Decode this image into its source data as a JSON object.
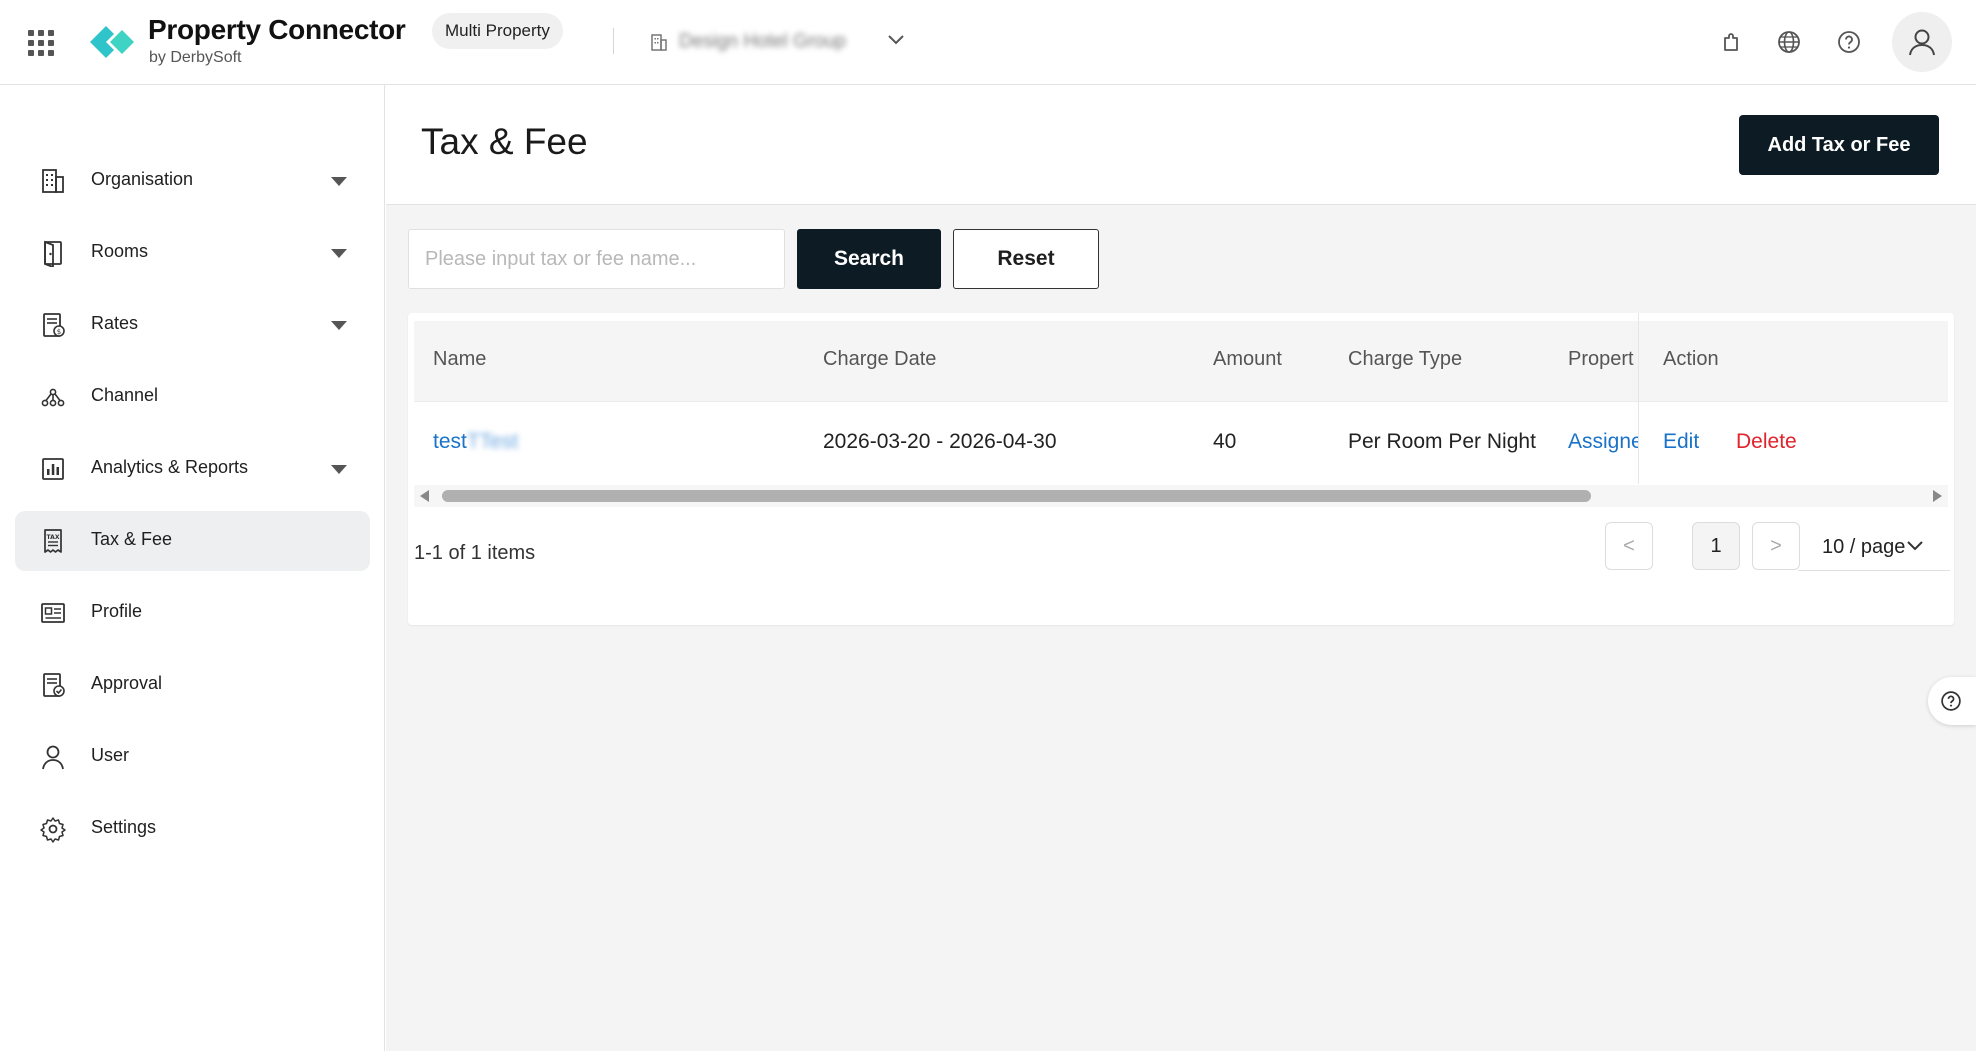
{
  "header": {
    "brand_title": "Property Connector",
    "brand_sub": "by DerbySoft",
    "mode_badge": "Multi Property",
    "org_name": "Design Hotel Group",
    "icons": [
      "apps-grid-icon",
      "logo-icon",
      "building-icon",
      "chevron-down-icon",
      "puzzle-icon",
      "globe-icon",
      "help-icon",
      "user-icon"
    ]
  },
  "sidebar": {
    "items": [
      {
        "label": "Organisation",
        "icon": "building-icon",
        "expandable": true
      },
      {
        "label": "Rooms",
        "icon": "door-icon",
        "expandable": true
      },
      {
        "label": "Rates",
        "icon": "rate-doc-icon",
        "expandable": true
      },
      {
        "label": "Channel",
        "icon": "channel-icon",
        "expandable": false
      },
      {
        "label": "Analytics & Reports",
        "icon": "chart-icon",
        "expandable": true
      },
      {
        "label": "Tax & Fee",
        "icon": "tax-icon",
        "expandable": false,
        "active": true
      },
      {
        "label": "Profile",
        "icon": "profile-card-icon",
        "expandable": false
      },
      {
        "label": "Approval",
        "icon": "approval-icon",
        "expandable": false
      },
      {
        "label": "User",
        "icon": "user-icon",
        "expandable": false
      },
      {
        "label": "Settings",
        "icon": "gear-icon",
        "expandable": false
      }
    ]
  },
  "page": {
    "title": "Tax & Fee",
    "add_button": "Add Tax or Fee"
  },
  "search": {
    "placeholder": "Please input tax or fee name...",
    "search_label": "Search",
    "reset_label": "Reset"
  },
  "table": {
    "columns": [
      "Name",
      "Charge Date",
      "Amount",
      "Charge Type",
      "Propert",
      "Action"
    ],
    "rows": [
      {
        "name": "test",
        "name_suffix": "TTest",
        "charge_date": "2026-03-20 - 2026-04-30",
        "amount": "40",
        "charge_type": "Per Room Per Night",
        "property": "Assigned",
        "edit": "Edit",
        "delete": "Delete"
      }
    ]
  },
  "pagination": {
    "total_text": "1-1 of 1 items",
    "prev": "<",
    "current_page": "1",
    "next": ">",
    "page_size": "10 / page"
  },
  "colors": {
    "primary_dark": "#0d1b24",
    "link_blue": "#1a73c9",
    "danger_red": "#e0232d",
    "brand_teal": "#2ec4c9"
  }
}
